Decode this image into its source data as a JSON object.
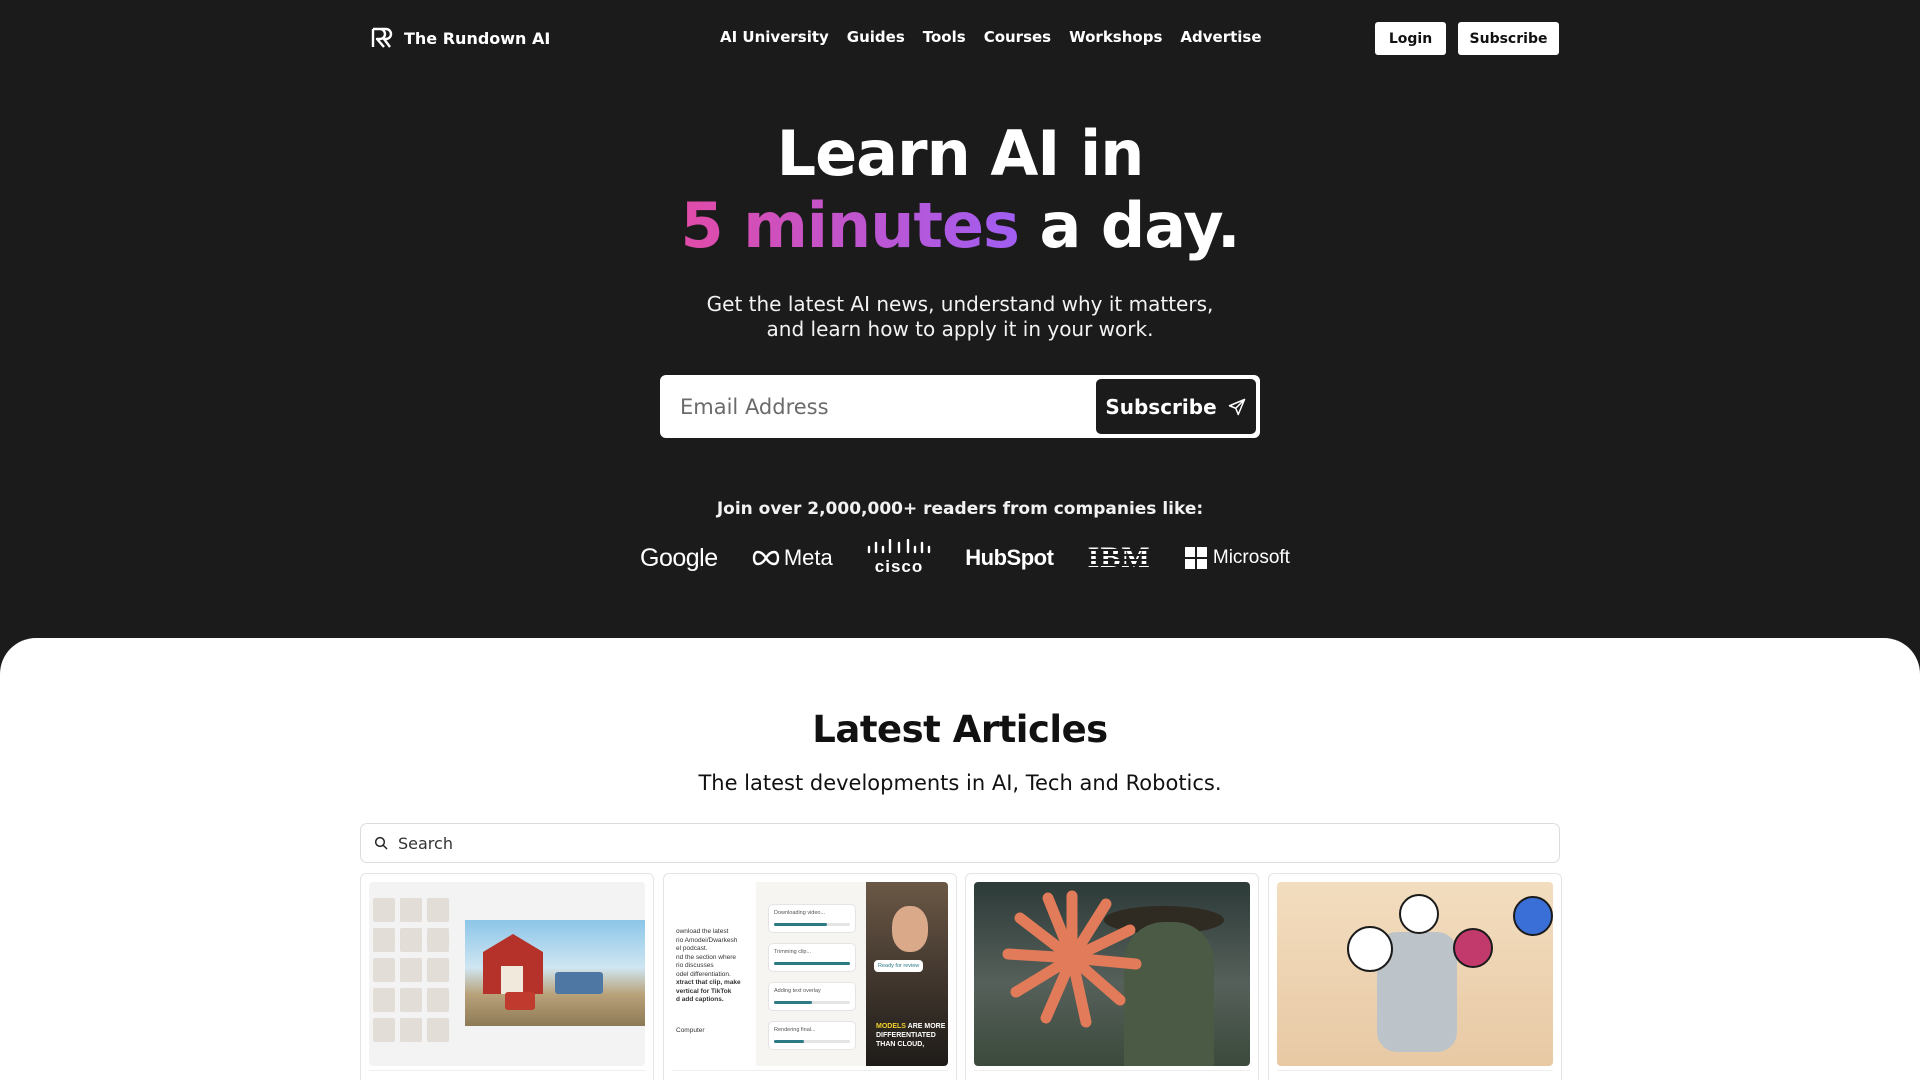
{
  "brand": {
    "name": "The Rundown AI",
    "logo_icon": "rundown-logo-icon"
  },
  "nav": [
    {
      "label": "AI University"
    },
    {
      "label": "Guides"
    },
    {
      "label": "Tools"
    },
    {
      "label": "Courses"
    },
    {
      "label": "Workshops"
    },
    {
      "label": "Advertise"
    }
  ],
  "header": {
    "login_label": "Login",
    "subscribe_label": "Subscribe"
  },
  "hero": {
    "title_line1": "Learn AI in",
    "title_highlight": "5 minutes",
    "title_rest": " a day.",
    "subtitle_line1": "Get the latest AI news, understand why it matters,",
    "subtitle_line2": "and learn how to apply it in your work.",
    "email_placeholder": "Email Address",
    "submit_label": "Subscribe",
    "submit_icon": "send-icon",
    "gradient_colors": [
      "#e14ba8",
      "#a05ef2"
    ]
  },
  "social_proof": {
    "text": "Join over 2,000,000+ readers from companies like:",
    "companies": [
      "Google",
      "Meta",
      "cisco",
      "HubSpot",
      "IBM",
      "Microsoft"
    ]
  },
  "articles": {
    "title": "Latest Articles",
    "subtitle": "The latest developments in AI, Tech and Robotics.",
    "search_placeholder": "Search",
    "search_icon": "search-icon",
    "card2": {
      "doc_lines": [
        "ownload the latest",
        "rio Amodei/Dwarkesh",
        "el podcast.",
        "nd the section where",
        "rio discusses",
        "odel differentiation.",
        "xtract that clip, make",
        "vertical for TikTok",
        "d add captions."
      ],
      "progress_labels": [
        "Downloading video...",
        "Trimming clip...",
        "Adding text overlay",
        "Rendering final..."
      ],
      "status": "Ready for review",
      "computer_label": "Computer",
      "caption_highlight": "MODELS",
      "caption_rest": " ARE MORE DIFFERENTIATED THAN CLOUD,"
    }
  },
  "colors": {
    "background_dark": "#1b1b1b",
    "accent_pink": "#e14ba8",
    "accent_purple": "#a05ef2",
    "sunburst": "#e27b59"
  }
}
